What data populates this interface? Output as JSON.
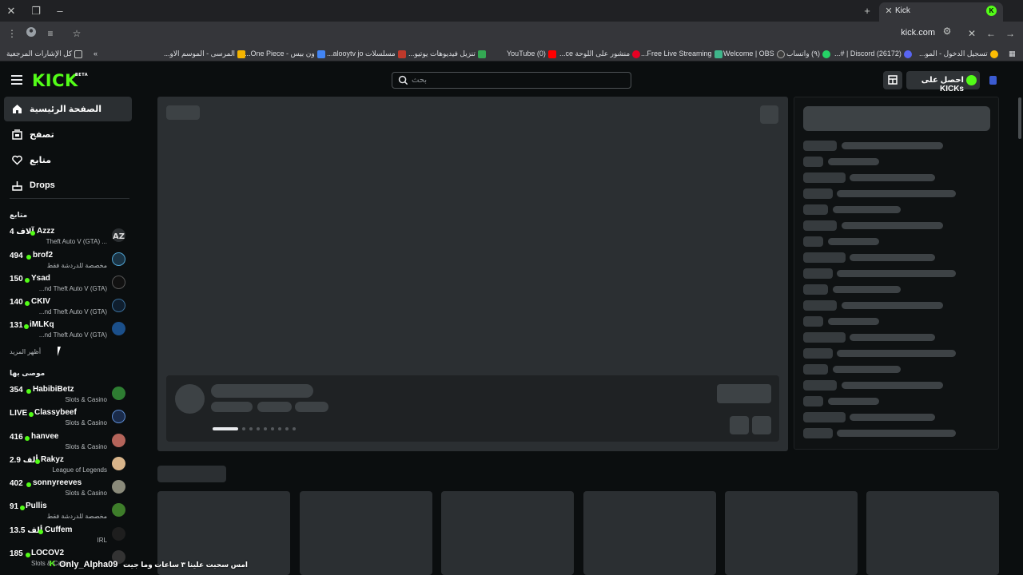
{
  "browser": {
    "tab_title": "Kick",
    "url": "kick.com",
    "bookmarks_all_label": "كل الإشارات المرجعية",
    "bookmarks": [
      "تسجيل الدخول - المو...",
      "(26172) Discord | #...",
      "(٩) واتساب",
      "Welcome | OBS",
      "Free Live Streaming...",
      "منشور على اللوحة ce...",
      "(0) YouTube",
      "تنزيل فيديوهات يوتيو...",
      "مسلسلات alooytv jo...",
      "ون بيس - One Piece...",
      "المرسى - الموسم الاو..."
    ],
    "colors": {
      "tabbar": "#202124",
      "toolbar": "#35363a"
    }
  },
  "header": {
    "logo": "KICK",
    "logo_badge": "BETA",
    "search_placeholder": "بحث",
    "get_kicks_label": "احصل على KICKs",
    "accent": "#53fc18"
  },
  "sidebar": {
    "nav": [
      {
        "label": "الصفحة الرئيسية",
        "icon": "home-icon",
        "active": true
      },
      {
        "label": "تصفح",
        "icon": "browse-icon",
        "active": false
      },
      {
        "label": "متابع",
        "icon": "heart-icon",
        "active": false
      },
      {
        "label": "Drops",
        "icon": "drops-icon",
        "active": false
      }
    ],
    "following_heading": "متابع",
    "following": [
      {
        "viewers": "4 آلاف",
        "name": "Azzz",
        "category": "Theft Auto V (GTA) ..."
      },
      {
        "viewers": "494",
        "name": "brof2",
        "category": "مخصصة للدردشة فقط"
      },
      {
        "viewers": "150",
        "name": "Ysad",
        "category": "...nd Theft Auto V (GTA)"
      },
      {
        "viewers": "140",
        "name": "CKIV",
        "category": "...nd Theft Auto V (GTA)"
      },
      {
        "viewers": "131",
        "name": "iMLKq",
        "category": "...nd Theft Auto V (GTA)"
      }
    ],
    "show_more": "أظهر المزيد",
    "recommended_heading": "موصى بها",
    "recommended": [
      {
        "viewers": "354",
        "name": "HabibiBetz",
        "category": "Slots & Casino"
      },
      {
        "viewers": "LIVE",
        "name": "Classybeef",
        "category": "Slots & Casino"
      },
      {
        "viewers": "416",
        "name": "hanvee",
        "category": "Slots & Casino"
      },
      {
        "viewers": "2.9 ألف",
        "name": "Rakyz",
        "category": "League of Legends"
      },
      {
        "viewers": "402",
        "name": "sonnyreeves",
        "category": "Slots & Casino"
      },
      {
        "viewers": "91",
        "name": "Pullis",
        "category": "مخصصة للدردشة فقط"
      },
      {
        "viewers": "13.5 ألف",
        "name": "Cuffem",
        "category": "IRL"
      },
      {
        "viewers": "185",
        "name": "LOCOV2",
        "category": "Slots & Casino"
      }
    ]
  },
  "overlay": {
    "username": "Only_Alpha09",
    "message": "امس سحبت علينا ٣ ساعات وما جيت"
  }
}
